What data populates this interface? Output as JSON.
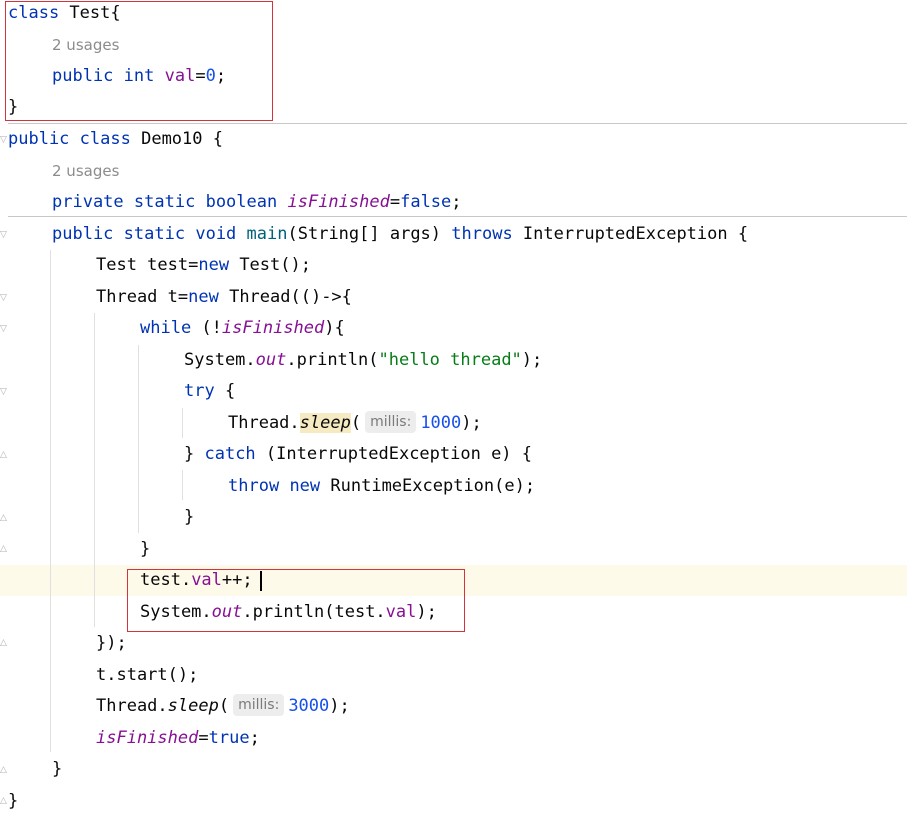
{
  "code": {
    "l_class_test": {
      "kw": "class",
      "name": " Test{"
    },
    "usages1": "2 usages",
    "l_val": {
      "kw1": "public",
      "kw2": "int",
      "field": "val",
      "eq": "=",
      "num": "0",
      "end": ";"
    },
    "l_close1": "}",
    "l_demo": {
      "kw1": "public",
      "kw2": "class",
      "name": " Demo10 {"
    },
    "usages2": "2 usages",
    "l_finished": {
      "kw1": "private",
      "kw2": "static",
      "kw3": "boolean",
      "field": "isFinished",
      "eq": "=",
      "kw4": "false",
      "end": ";"
    },
    "l_main": {
      "kw1": "public",
      "kw2": "static",
      "kw3": "void",
      "method": "main",
      "params": "(String[] args) ",
      "kw4": "throws",
      "rest": " InterruptedException {"
    },
    "l_test": {
      "t1": "Test test=",
      "kw": "new",
      "t2": " Test();"
    },
    "l_thread": {
      "t1": "Thread t=",
      "kw": "new",
      "t2": " Thread(()->{"
    },
    "l_while": {
      "kw": "while",
      "t1": " (!",
      "field": "isFinished",
      "t2": "){"
    },
    "l_print": {
      "t1": "System.",
      "field": "out",
      "t2": ".println(",
      "str": "\"hello thread\"",
      "t3": ");"
    },
    "l_try": {
      "kw": "try",
      "t1": " {"
    },
    "l_sleep1": {
      "t1": "Thread.",
      "method": "sleep",
      "t2": "(",
      "hint": "millis:",
      "num": "1000",
      "t3": ");"
    },
    "l_catch": {
      "t1": "} ",
      "kw": "catch",
      "t2": " (InterruptedException e) {"
    },
    "l_throw": {
      "kw1": "throw",
      "kw2": "new",
      "t1": " RuntimeException(e);"
    },
    "l_close2": "}",
    "l_close3": "}",
    "l_inc": {
      "t1": "test.",
      "field": "val",
      "t2": "++;"
    },
    "l_print2": {
      "t1": "System.",
      "field": "out",
      "t2": ".println(test.",
      "field2": "val",
      "t3": ");"
    },
    "l_close4": "});",
    "l_start": "t.start();",
    "l_sleep2": {
      "t1": "Thread.",
      "method": "sleep",
      "t2": "(",
      "hint": "millis:",
      "num": "3000",
      "t3": ");"
    },
    "l_set": {
      "field": "isFinished",
      "eq": "=",
      "kw": "true",
      "end": ";"
    },
    "l_close5": "}",
    "l_close6": "}"
  },
  "colors": {
    "keyword": "#0033b3",
    "field": "#871094",
    "number": "#1750eb",
    "string": "#067d17",
    "highlight_box": "#d3333d",
    "caret_line": "#fdfaea"
  }
}
